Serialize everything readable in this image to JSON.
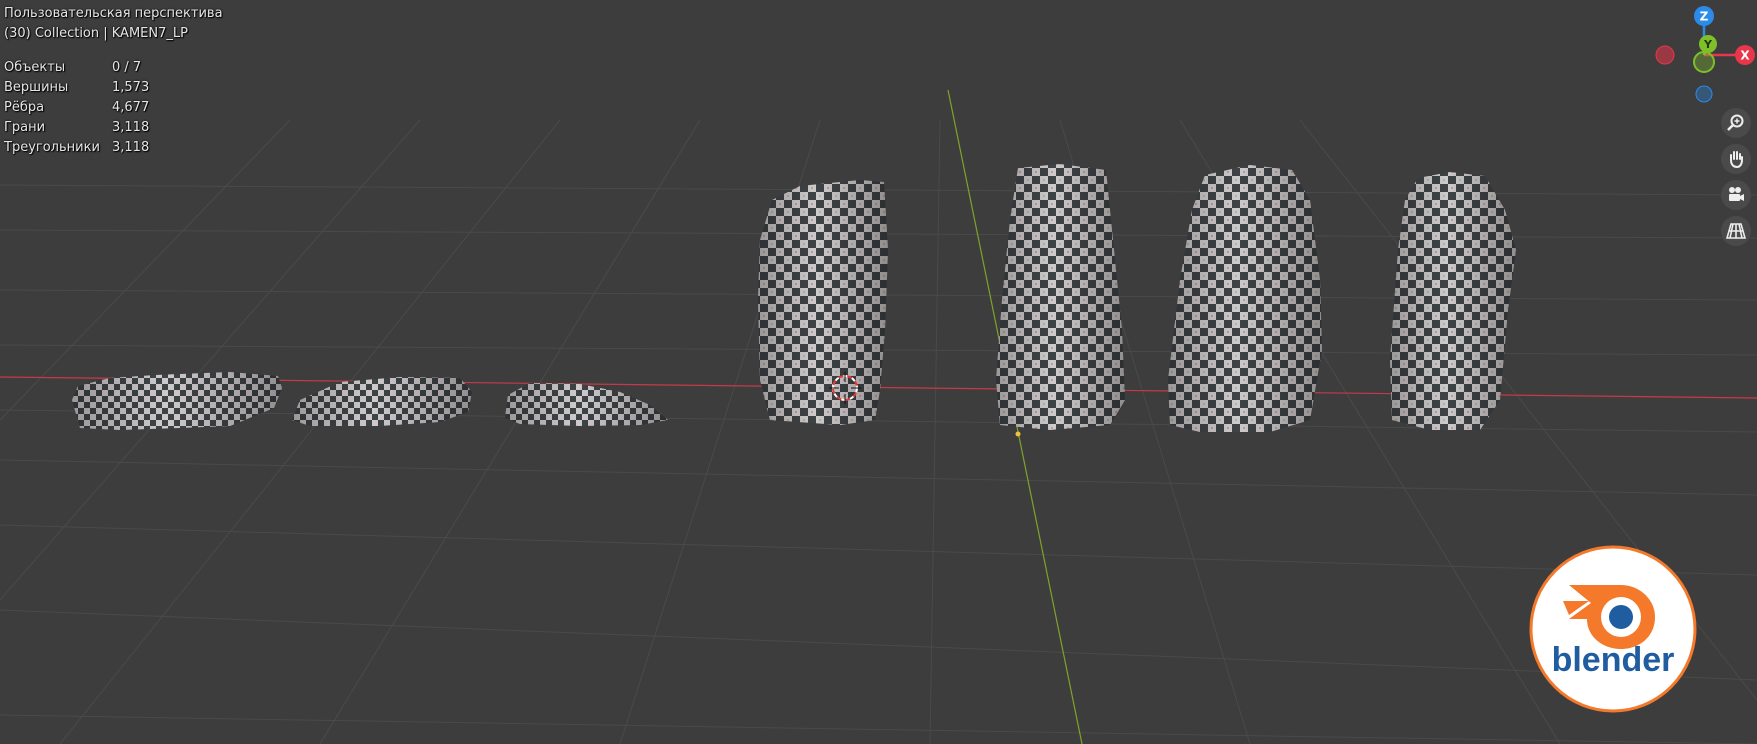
{
  "viewport": {
    "view_name": "Пользовательская перспектива",
    "collection_info": "(30) Collection | KAMEN7_LP",
    "stats": [
      {
        "label": "Объекты",
        "value": "0 / 7"
      },
      {
        "label": "Вершины",
        "value": "1,573"
      },
      {
        "label": "Рёбра",
        "value": "4,677"
      },
      {
        "label": "Грани",
        "value": "3,118"
      },
      {
        "label": "Треугольники",
        "value": "3,118"
      }
    ]
  },
  "gizmo": {
    "z_label": "Z",
    "y_label": "Y",
    "x_label": "X",
    "colors": {
      "x": "#e8374a",
      "y": "#7fbf2a",
      "z": "#2a8be8"
    }
  },
  "tools": [
    "zoom-icon",
    "hand-pan-icon",
    "camera-icon",
    "grid-perspective-icon"
  ],
  "watermark": {
    "text": "blender",
    "colors": {
      "orange": "#f5792a",
      "blue": "#1f5ca0"
    }
  },
  "scene": {
    "object_count": 7,
    "object_names": [
      "KAMEN7_LP"
    ]
  }
}
